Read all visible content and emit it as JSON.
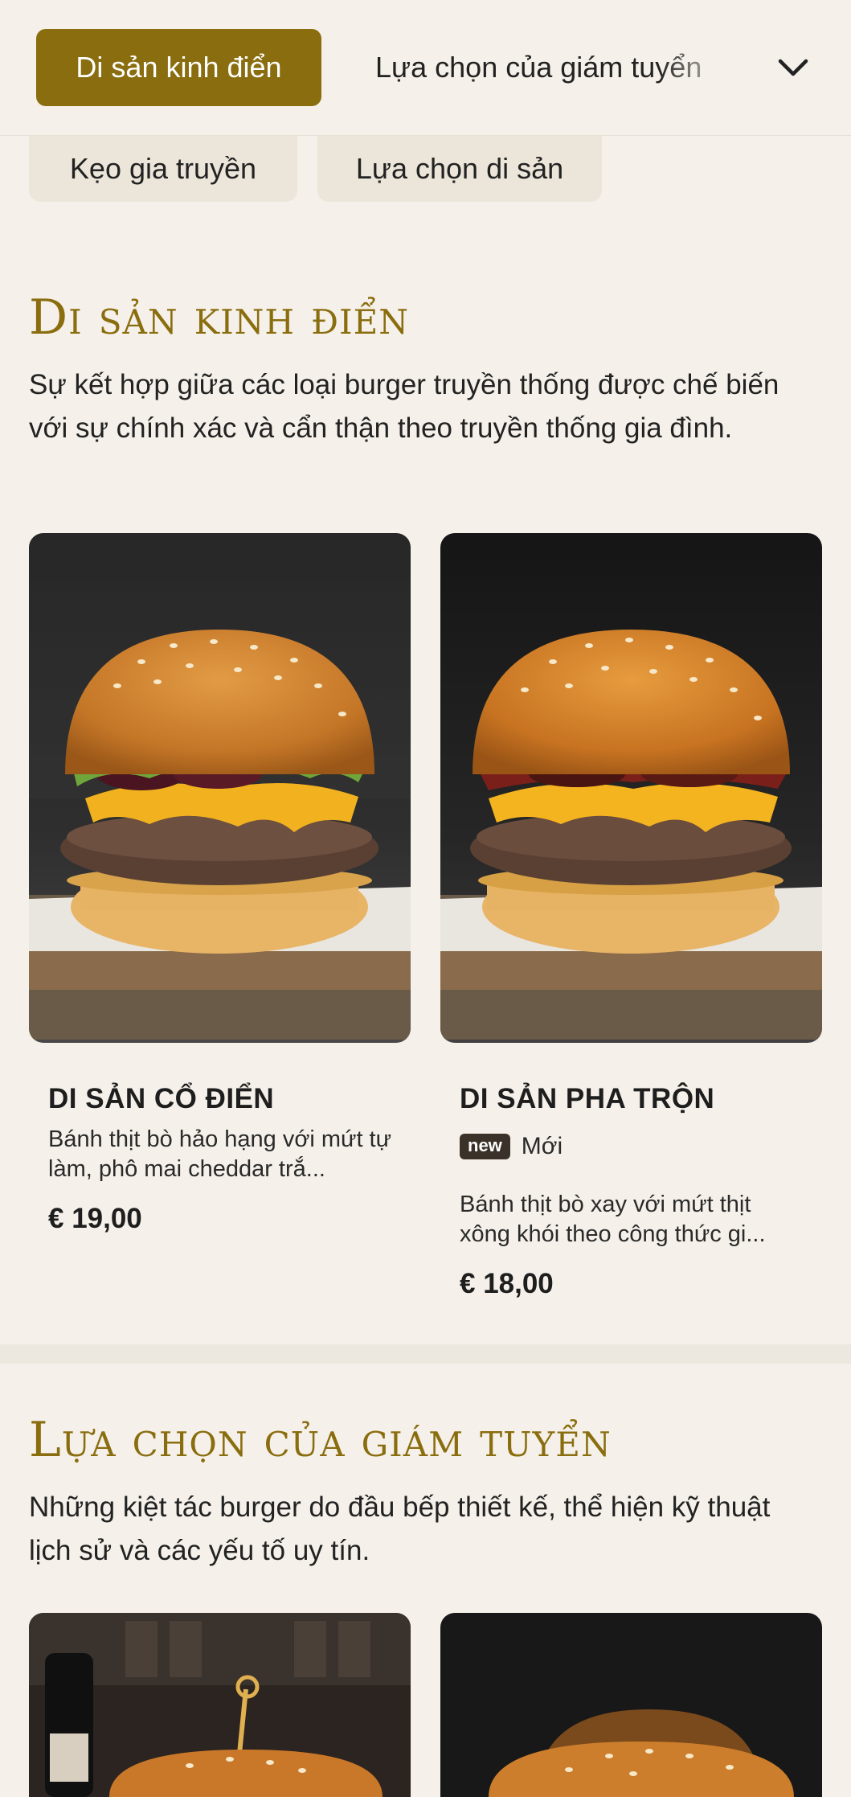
{
  "nav": {
    "active_tab": "Di sản kinh điển",
    "next_tab": "Lựa chọn của giám tuyển",
    "expand_icon": "chevron-down-icon"
  },
  "chips": [
    "Kẹo gia truyền",
    "Lựa chọn di sản"
  ],
  "sections": [
    {
      "title": "Di sản kinh điển",
      "description": "Sự kết hợp giữa các loại burger truyền thống được chế biến với sự chính xác và cẩn thận theo truyền thống gia đình.",
      "products": [
        {
          "name": "DI SẢN CỔ ĐIỂN",
          "description": "Bánh thịt bò hảo hạng với mứt tự làm, phô mai cheddar trắ...",
          "price": "€ 19,00"
        },
        {
          "name": "DI SẢN PHA TRỘN",
          "badge": "new",
          "badge_label": "Mới",
          "description": "Bánh thịt bò xay với mứt thịt xông khói theo công thức gi...",
          "price": "€ 18,00"
        }
      ]
    },
    {
      "title": "Lựa chọn của giám tuyển",
      "description": "Những kiệt tác burger do đầu bếp thiết kế, thể hiện kỹ thuật lịch sử và các yếu tố uy tín."
    }
  ],
  "colors": {
    "accent": "#8a6d0e",
    "background": "#f5f1ea",
    "chip": "#ece6da",
    "badge": "#3a3128"
  }
}
